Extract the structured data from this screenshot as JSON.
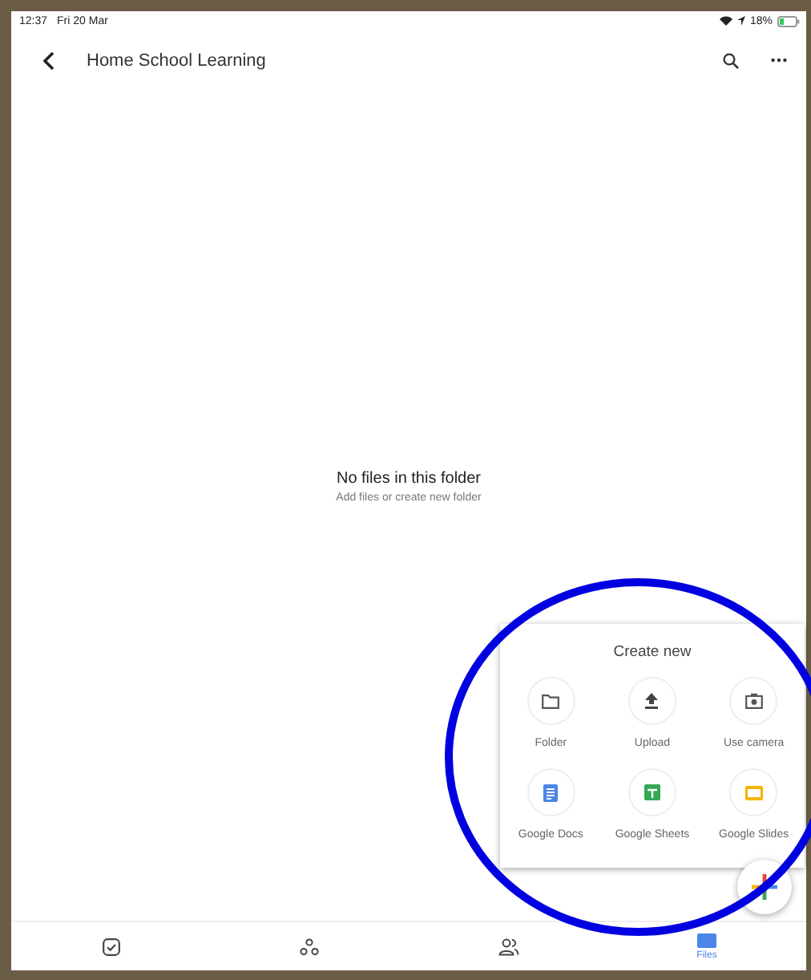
{
  "status_bar": {
    "time": "12:37",
    "date": "Fri 20 Mar",
    "battery": "18%"
  },
  "header": {
    "title": "Home School Learning"
  },
  "empty_state": {
    "title": "No files in this folder",
    "subtitle": "Add files or create new folder"
  },
  "create_menu": {
    "title": "Create new",
    "items": [
      {
        "kind": "folder",
        "label": "Folder"
      },
      {
        "kind": "upload",
        "label": "Upload"
      },
      {
        "kind": "camera",
        "label": "Use camera"
      },
      {
        "kind": "docs",
        "label": "Google Docs"
      },
      {
        "kind": "sheets",
        "label": "Google Sheets"
      },
      {
        "kind": "slides",
        "label": "Google Slides"
      }
    ]
  },
  "bottom_nav": [
    {
      "kind": "tasks",
      "selected": false
    },
    {
      "kind": "shared",
      "selected": false
    },
    {
      "kind": "people",
      "selected": false
    },
    {
      "kind": "files",
      "label": "Files",
      "selected": true
    }
  ]
}
